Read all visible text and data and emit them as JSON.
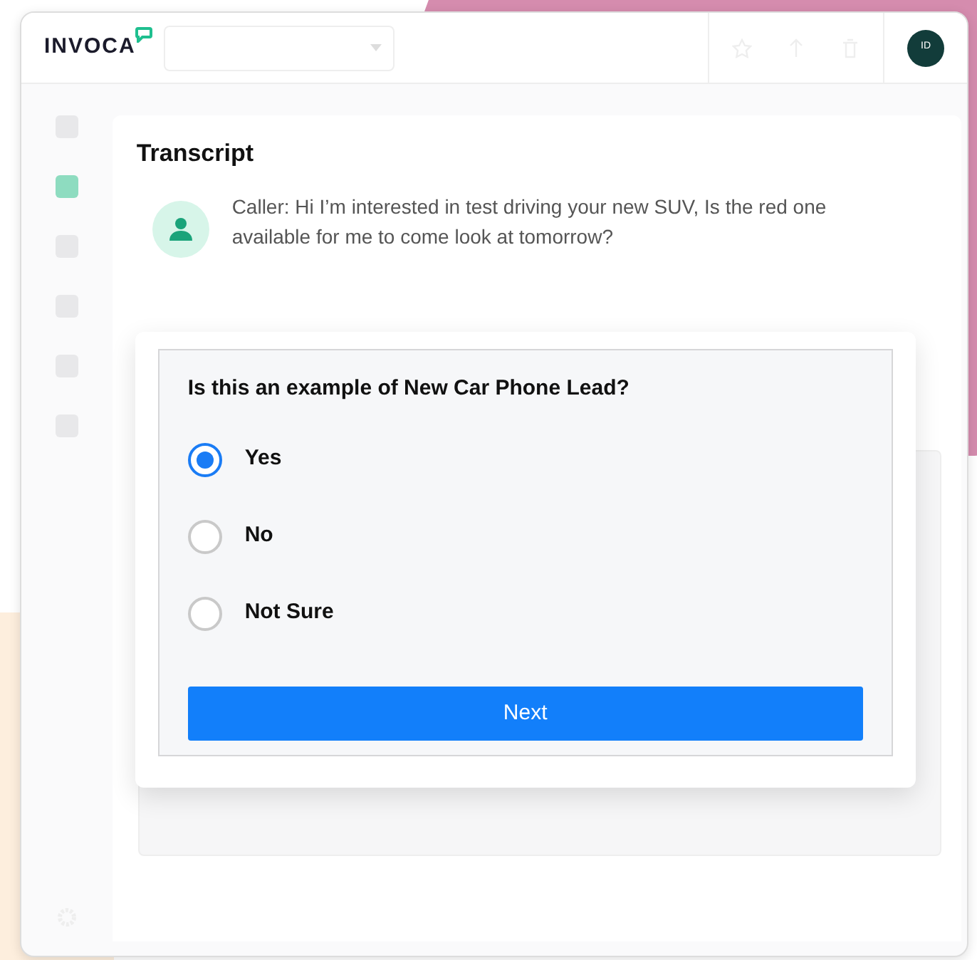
{
  "header": {
    "logo": "INVOCA",
    "account_dropdown": {
      "value_shown": false
    },
    "avatar": "ID"
  },
  "sidebar": {
    "items": [
      {
        "selected": false
      },
      {
        "selected": true
      },
      {
        "selected": false
      },
      {
        "selected": false
      },
      {
        "selected": false
      },
      {
        "selected": false
      }
    ]
  },
  "transcript": {
    "title": "Transcript",
    "message": "Caller: Hi I’m interested in test driving your new SUV, Is the red one available for me to come look at tomorrow?"
  },
  "question": {
    "prompt": "Is this an example of New Car Phone Lead?",
    "options": [
      {
        "label": "Yes",
        "selected": true
      },
      {
        "label": "No",
        "selected": false
      },
      {
        "label": "Not Sure",
        "selected": false
      }
    ],
    "button": "Next"
  }
}
